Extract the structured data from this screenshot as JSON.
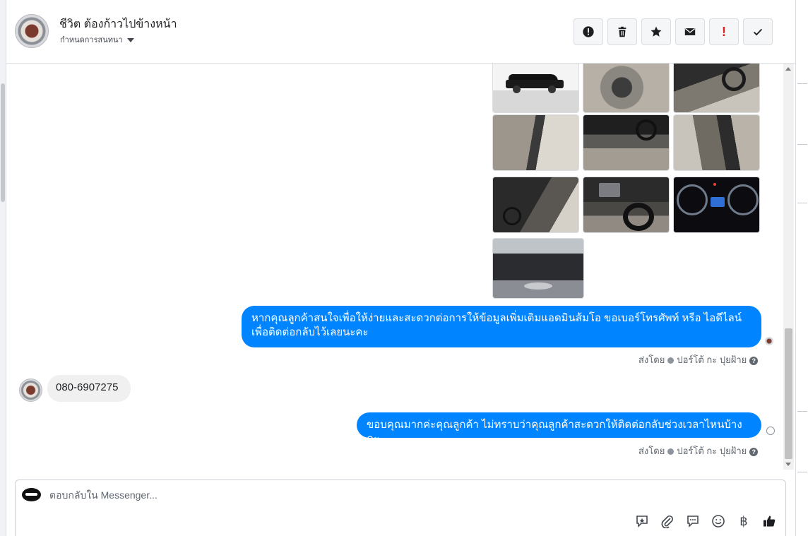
{
  "conversation": {
    "title": "ชีวิต ต้องก้าวไปข้างหน้า",
    "subtitle": "กำหนดการสนทนา"
  },
  "toolbar": {
    "buttons": [
      {
        "icon": "alert-circle-icon"
      },
      {
        "icon": "trash-icon"
      },
      {
        "icon": "star-icon"
      },
      {
        "icon": "envelope-icon"
      },
      {
        "icon": "exclamation-icon",
        "label": "!"
      },
      {
        "icon": "checkmark-icon"
      }
    ]
  },
  "photos": [
    {
      "scene": "black-pickup-truck-side"
    },
    {
      "scene": "gear-shifter"
    },
    {
      "scene": "dashboard-steering"
    },
    {
      "scene": "driver-seat"
    },
    {
      "scene": "dashboard-wide"
    },
    {
      "scene": "rear-seat"
    },
    {
      "scene": "door-panel"
    },
    {
      "scene": "steering-wheel-toyota"
    },
    {
      "scene": "instrument-cluster"
    },
    {
      "scene": "engine-bay-front"
    }
  ],
  "messages": [
    {
      "direction": "out",
      "text_line1": "หากคุณลูกค้าสนใจเพื่อให้ง่ายและสะดวกต่อการให้ข้อมูลเพิ่มเติมแอดมินส้มโอ ขอเบอร์โทรศัพท์ หรือ ไอดีไลน์",
      "text_line2": "เพื่อติดต่อกลับไว้เลยนะคะ",
      "sent_by_label": "ส่งโดย",
      "sender": "ปอร์โต้ กะ ปุยฝ้าย"
    },
    {
      "direction": "in",
      "text": "080-6907275"
    },
    {
      "direction": "out",
      "text": "ขอบคุณมากค่ะคุณลูกค้า ไม่ทราบว่าคุณลูกค้าสะดวกให้ติดต่อกลับช่วงเวลาไหนบ้างคะ",
      "sent_by_label": "ส่งโดย",
      "sender": "ปอร์โต้ กะ ปุยฝ้าย"
    }
  ],
  "composer": {
    "placeholder": "ตอบกลับใน Messenger...",
    "icons": [
      "saved-reply-icon",
      "paperclip-icon",
      "chat-bubble-icon",
      "emoji-icon",
      "baht-icon",
      "thumbs-up-icon"
    ],
    "baht_symbol": "฿"
  },
  "colors": {
    "accent": "#0084ff",
    "incoming_bubble": "#f0f0f0",
    "alert_red": "#e02020"
  }
}
